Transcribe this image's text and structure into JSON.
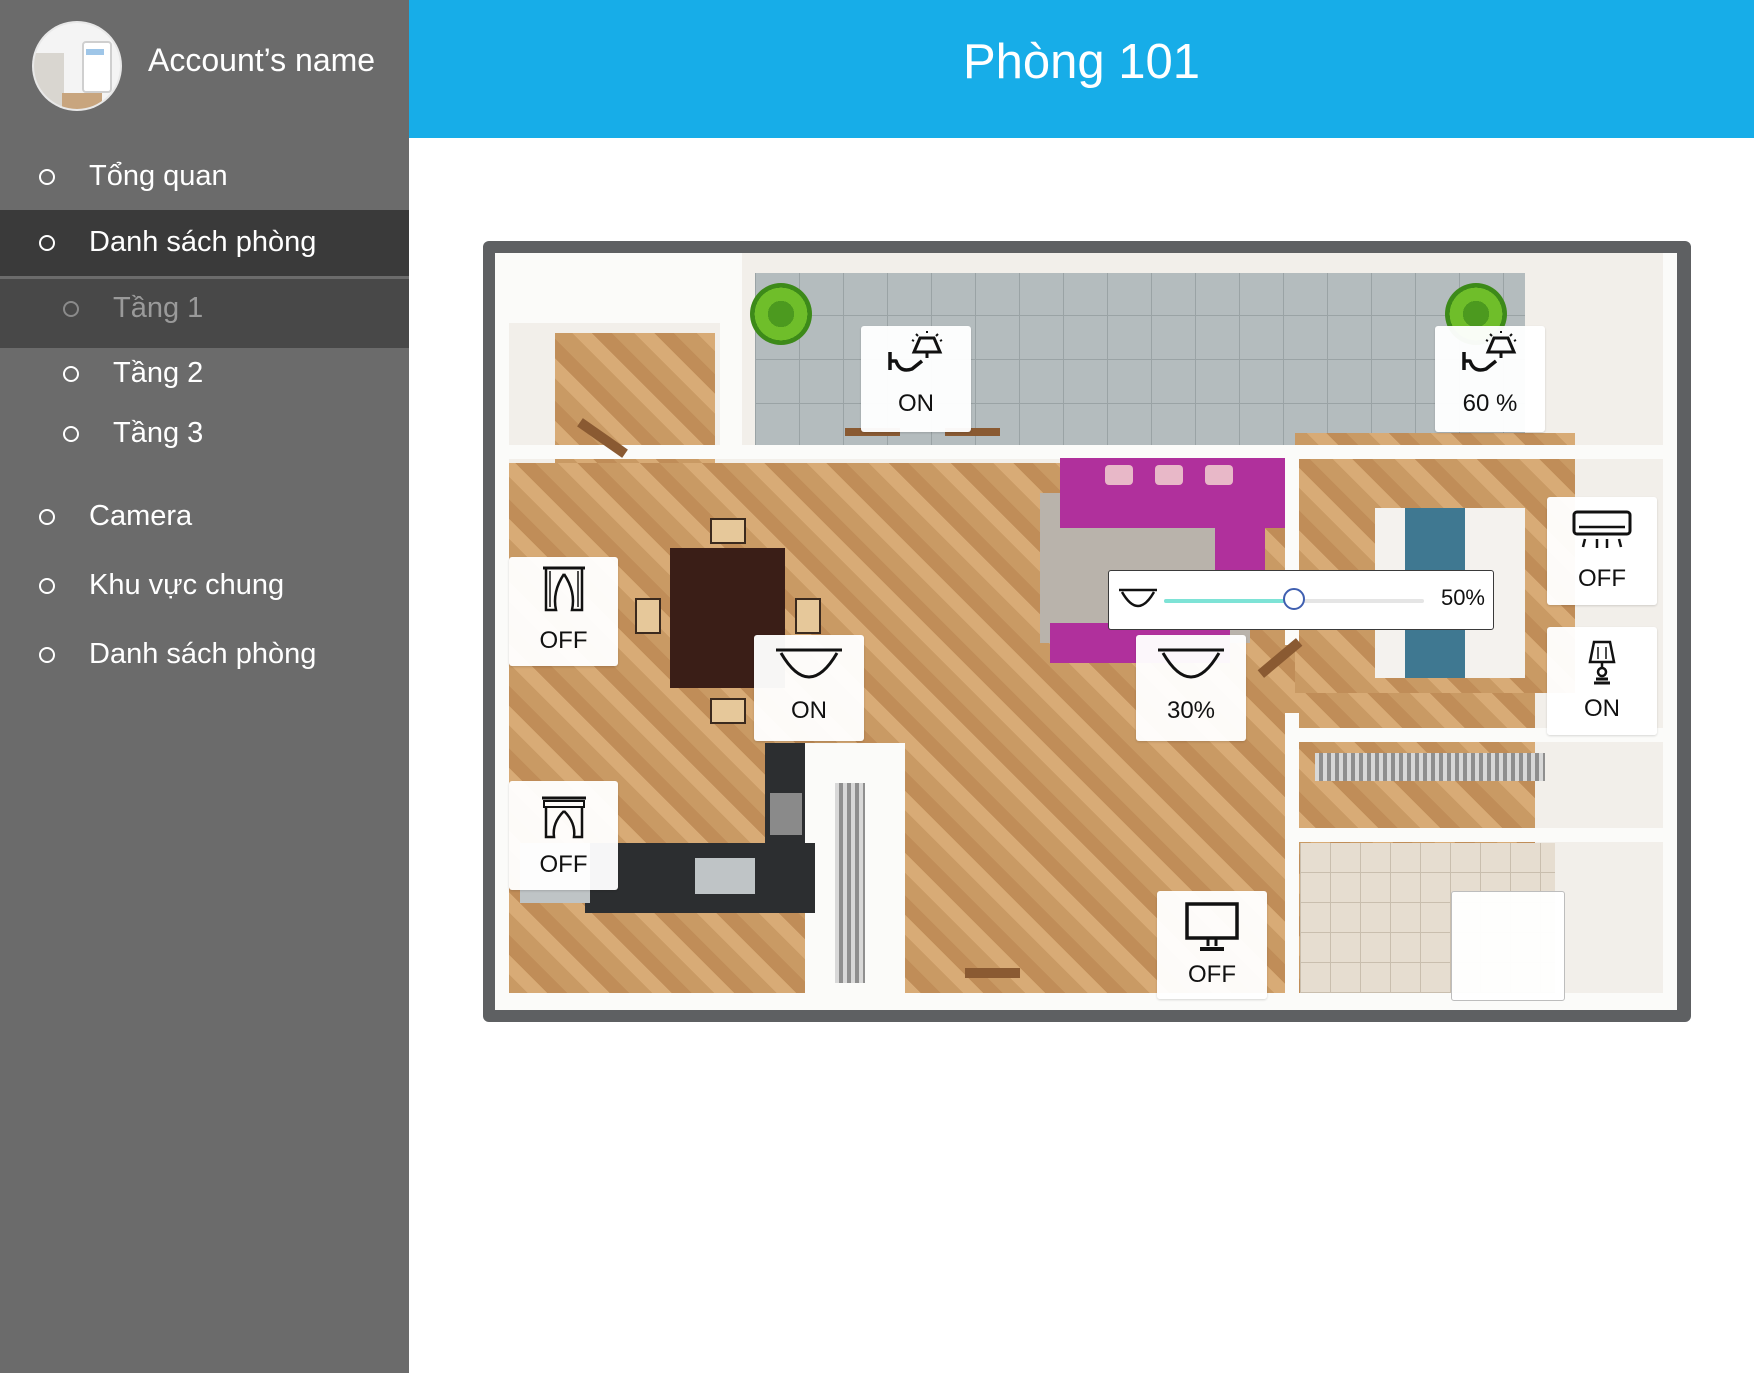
{
  "account": {
    "name": "Account’s name"
  },
  "header": {
    "title": "Phòng 101"
  },
  "sidebar": {
    "items": [
      {
        "label": "Tổng quan"
      },
      {
        "label": "Danh sách phòng"
      },
      {
        "label": "Tầng 1"
      },
      {
        "label": "Tầng 2"
      },
      {
        "label": "Tầng 3"
      },
      {
        "label": "Camera"
      },
      {
        "label": "Khu vực chung"
      },
      {
        "label": "Danh sách phòng"
      }
    ]
  },
  "devices": {
    "wall_lamp_left": {
      "icon": "wall-lamp-icon",
      "state": "ON"
    },
    "wall_lamp_right": {
      "icon": "wall-lamp-icon",
      "state": "60 %"
    },
    "air_conditioner": {
      "icon": "air-conditioner-icon",
      "state": "OFF"
    },
    "table_lamp": {
      "icon": "table-lamp-icon",
      "state": "ON"
    },
    "curtain_top": {
      "icon": "curtain-icon",
      "state": "OFF"
    },
    "curtain_bottom": {
      "icon": "curtain-icon",
      "state": "OFF"
    },
    "ceiling_light_dining": {
      "icon": "ceiling-light-icon",
      "state": "ON"
    },
    "ceiling_light_living": {
      "icon": "ceiling-light-icon",
      "state": "30%"
    },
    "tv": {
      "icon": "monitor-icon",
      "state": "OFF"
    }
  },
  "dimmer": {
    "icon": "ceiling-light-icon",
    "value_label": "50%",
    "value": 0.5
  },
  "colors": {
    "header": "#17ade8",
    "sidebar": "#6b6b6b",
    "active": "#3a3a3a",
    "slider_fill": "#7ee3d6"
  }
}
